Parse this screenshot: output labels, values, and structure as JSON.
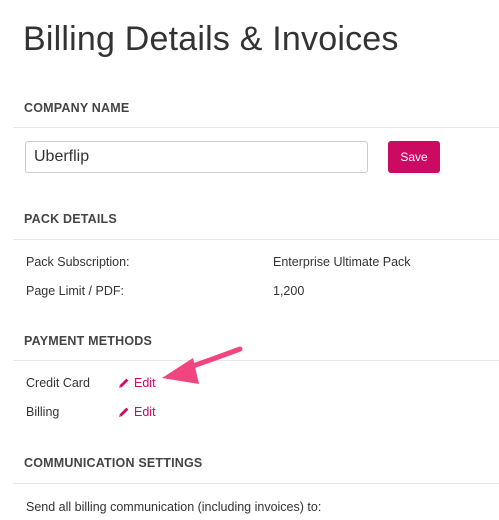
{
  "page": {
    "title": "Billing Details & Invoices"
  },
  "company": {
    "heading": "COMPANY NAME",
    "input_value": "Uberflip",
    "save_label": "Save"
  },
  "pack": {
    "heading": "PACK DETAILS",
    "rows": [
      {
        "label": "Pack Subscription:",
        "value": "Enterprise Ultimate Pack"
      },
      {
        "label": "Page Limit / PDF:",
        "value": "1,200"
      }
    ]
  },
  "payment": {
    "heading": "PAYMENT METHODS",
    "rows": [
      {
        "label": "Credit Card",
        "action": "Edit",
        "icon": "pencil-icon"
      },
      {
        "label": "Billing",
        "action": "Edit",
        "icon": "pencil-icon"
      }
    ]
  },
  "communication": {
    "heading": "COMMUNICATION SETTINGS",
    "description": "Send all billing communication (including invoices) to:"
  },
  "colors": {
    "accent": "#cc0a63",
    "annotation_arrow": "#f0457e",
    "divider": "#e6e6e6",
    "text": "#333333"
  },
  "annotation": {
    "icon": "arrow-annotation-icon"
  }
}
